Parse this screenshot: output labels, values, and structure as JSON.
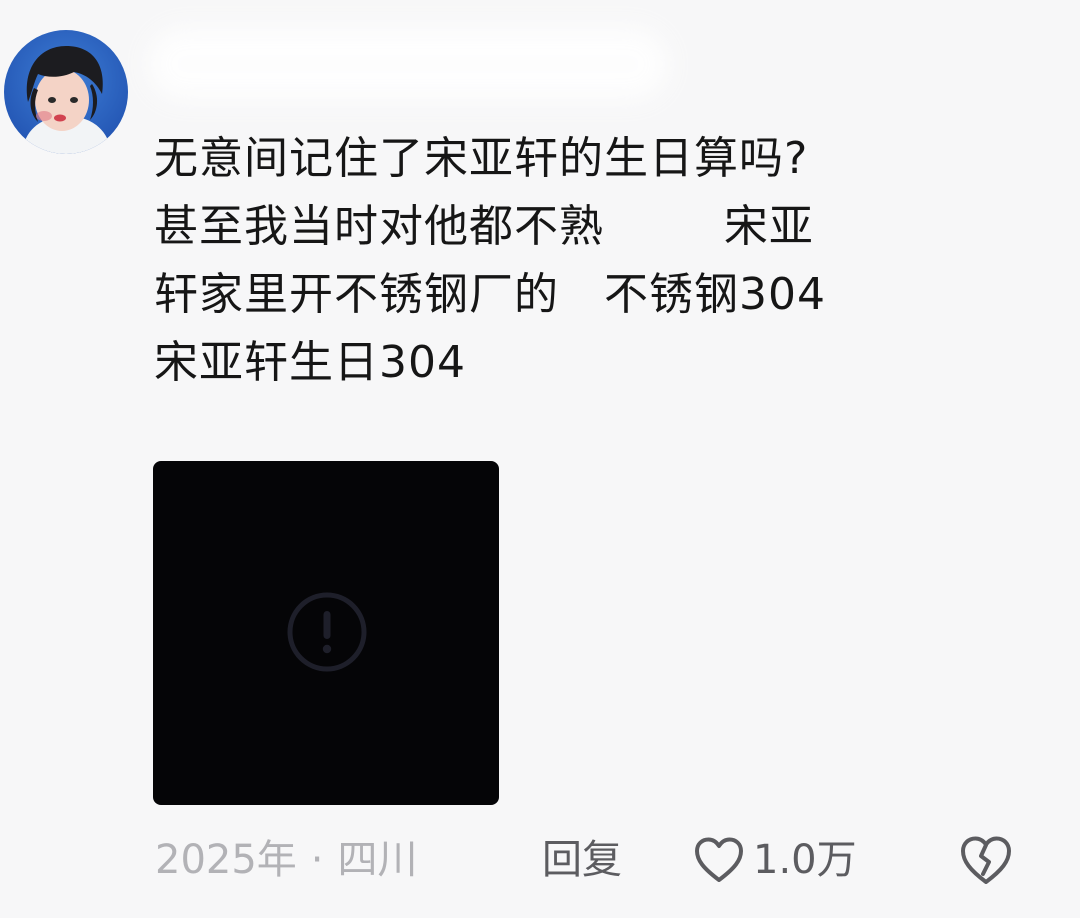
{
  "comment": {
    "avatar_icon": "user-avatar",
    "text_lines": [
      "无意间记住了宋亚轩的生日算吗?",
      "甚至我当时对他都不熟        宋亚",
      "轩家里开不锈钢厂的   不锈钢304",
      "宋亚轩生日304"
    ],
    "media": {
      "icon": "exclamation-circle-icon"
    },
    "footer": {
      "year": "2025年",
      "separator": "·",
      "location": "四川",
      "reply_label": "回复",
      "like_icon": "heart-outline-icon",
      "like_count": "1.0万",
      "dislike_icon": "broken-heart-icon"
    }
  }
}
